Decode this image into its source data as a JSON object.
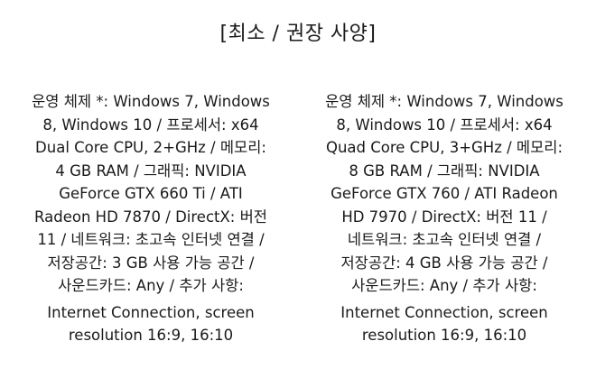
{
  "title": "[최소 / 권장 사양]",
  "minimum": {
    "lines": [
      "운영 체제 *: Windows 7, Windows",
      "8, Windows 10 / 프로세서: x64",
      "Dual Core CPU, 2+GHz / 메모리:",
      "4 GB RAM / 그래픽: NVIDIA",
      "GeForce GTX 660 Ti / ATI",
      "Radeon HD 7870 / DirectX: 버전",
      "11 / 네트워크: 초고속 인터넷 연결 /",
      "저장공간: 3 GB 사용 가능 공간 /",
      "사운드카드: Any / 추가 사항:",
      "Internet Connection, screen",
      "resolution 16:9, 16:10"
    ]
  },
  "recommended": {
    "lines": [
      "운영 체제 *: Windows 7, Windows",
      "8, Windows 10 / 프로세서: x64",
      "Quad Core CPU, 3+GHz / 메모리:",
      "8 GB RAM / 그래픽: NVIDIA",
      "GeForce GTX 760 / ATI Radeon",
      "HD 7970 / DirectX: 버전 11 /",
      "네트워크: 초고속 인터넷 연결 /",
      "저장공간: 4 GB 사용 가능 공간 /",
      "사운드카드: Any / 추가 사항:",
      "Internet Connection, screen",
      "resolution 16:9, 16:10"
    ]
  }
}
